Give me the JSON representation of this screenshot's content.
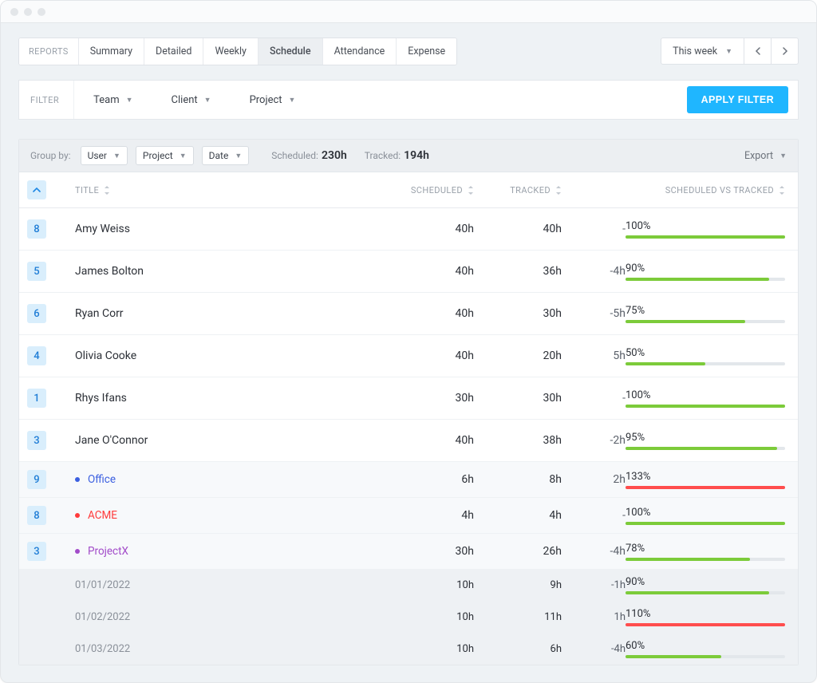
{
  "tabs": {
    "label": "REPORTS",
    "items": [
      "Summary",
      "Detailed",
      "Weekly",
      "Schedule",
      "Attendance",
      "Expense"
    ],
    "active": "Schedule"
  },
  "daterange": {
    "label": "This week"
  },
  "filter": {
    "label": "FILTER",
    "team": "Team",
    "client": "Client",
    "project": "Project",
    "apply": "APPLY FILTER"
  },
  "groupby": {
    "label": "Group by:",
    "selects": [
      "User",
      "Project",
      "Date"
    ],
    "scheduled_label": "Scheduled:",
    "scheduled_value": "230h",
    "tracked_label": "Tracked:",
    "tracked_value": "194h",
    "export": "Export"
  },
  "columns": {
    "title": "TITLE",
    "scheduled": "SCHEDULED",
    "tracked": "TRACKED",
    "vs": "SCHEDULED VS TRACKED"
  },
  "colors": {
    "green": "#7ccb3a",
    "red": "#ff4d4d",
    "blue_text": "#3b5fe0",
    "red_text": "#ff3b3b",
    "purple_text": "#a24cc9"
  },
  "rows": [
    {
      "type": "user",
      "badge": "8",
      "title": "Amy Weiss",
      "scheduled": "40h",
      "tracked": "40h",
      "delta": "-",
      "pct": "100%",
      "bar": 100,
      "barColor": "green"
    },
    {
      "type": "user",
      "badge": "5",
      "title": "James Bolton",
      "scheduled": "40h",
      "tracked": "36h",
      "delta": "-4h",
      "pct": "90%",
      "bar": 90,
      "barColor": "green"
    },
    {
      "type": "user",
      "badge": "6",
      "title": "Ryan Corr",
      "scheduled": "40h",
      "tracked": "30h",
      "delta": "-5h",
      "pct": "75%",
      "bar": 75,
      "barColor": "green"
    },
    {
      "type": "user",
      "badge": "4",
      "title": "Olivia Cooke",
      "scheduled": "40h",
      "tracked": "20h",
      "delta": "5h",
      "pct": "50%",
      "bar": 50,
      "barColor": "green"
    },
    {
      "type": "user",
      "badge": "1",
      "title": "Rhys Ifans",
      "scheduled": "30h",
      "tracked": "30h",
      "delta": "-",
      "pct": "100%",
      "bar": 100,
      "barColor": "green"
    },
    {
      "type": "user",
      "badge": "3",
      "title": "Jane O'Connor",
      "scheduled": "40h",
      "tracked": "38h",
      "delta": "-2h",
      "pct": "95%",
      "bar": 95,
      "barColor": "green"
    },
    {
      "type": "project",
      "badge": "9",
      "title": "Office",
      "dotColor": "#3b5fe0",
      "textColor": "blue_text",
      "scheduled": "6h",
      "tracked": "8h",
      "delta": "2h",
      "pct": "133%",
      "bar": 100,
      "barColor": "red"
    },
    {
      "type": "project",
      "badge": "8",
      "title": "ACME",
      "dotColor": "#ff3b3b",
      "textColor": "red_text",
      "scheduled": "4h",
      "tracked": "4h",
      "delta": "-",
      "pct": "100%",
      "bar": 100,
      "barColor": "green"
    },
    {
      "type": "project",
      "badge": "3",
      "title": "ProjectX",
      "dotColor": "#a24cc9",
      "textColor": "purple_text",
      "scheduled": "30h",
      "tracked": "26h",
      "delta": "-4h",
      "pct": "78%",
      "bar": 78,
      "barColor": "green"
    },
    {
      "type": "date",
      "title": "01/01/2022",
      "scheduled": "10h",
      "tracked": "9h",
      "delta": "-1h",
      "pct": "90%",
      "bar": 90,
      "barColor": "green"
    },
    {
      "type": "date",
      "title": "01/02/2022",
      "scheduled": "10h",
      "tracked": "11h",
      "delta": "1h",
      "pct": "110%",
      "bar": 100,
      "barColor": "red"
    },
    {
      "type": "date",
      "title": "01/03/2022",
      "scheduled": "10h",
      "tracked": "6h",
      "delta": "-4h",
      "pct": "60%",
      "bar": 60,
      "barColor": "green"
    }
  ]
}
